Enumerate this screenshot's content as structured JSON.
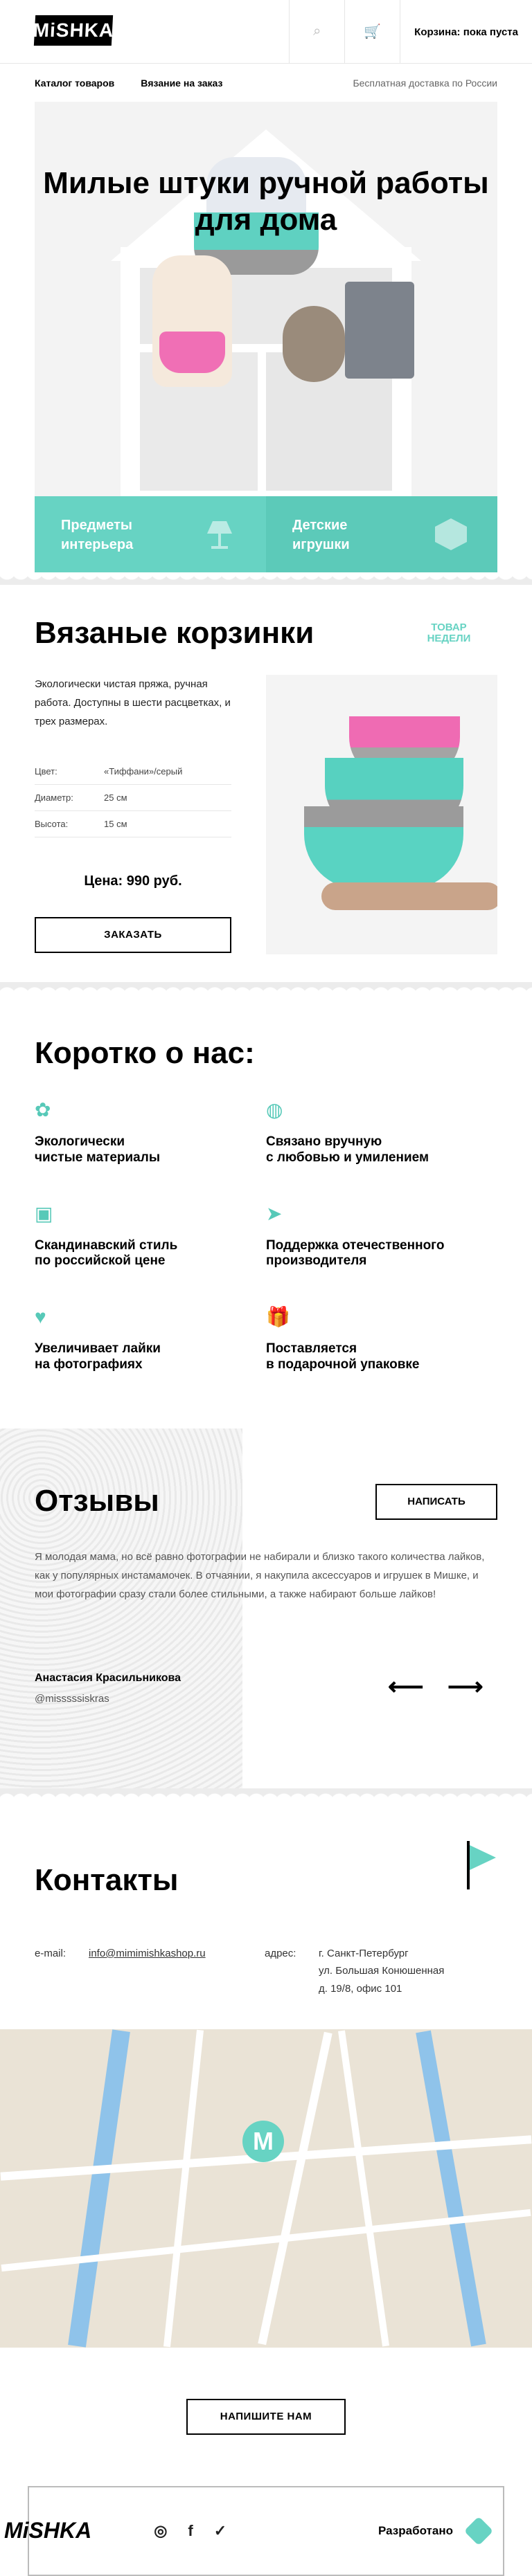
{
  "header": {
    "logo": "MiSHKA",
    "cart": "Корзина: пока пуста"
  },
  "nav": {
    "items": [
      "Каталог товаров",
      "Вязание на заказ"
    ],
    "shipping": "Бесплатная доставка по России"
  },
  "hero": {
    "title": "Милые штуки ручной работы для дома",
    "tiles": [
      "Предметы интерьера",
      "Детские игрушки"
    ]
  },
  "product": {
    "title": "Вязаные корзинки",
    "badge": "ТОВАР НЕДЕЛИ",
    "description": "Экологически чистая пряжа, ручная работа. Доступны в шести расцветках, и трех размерах.",
    "specs": [
      {
        "k": "Цвет:",
        "v": "«Тиффани»/серый"
      },
      {
        "k": "Диаметр:",
        "v": "25 см"
      },
      {
        "k": "Высота:",
        "v": "15 см"
      }
    ],
    "price": "Цена: 990 руб.",
    "button": "ЗАКАЗАТЬ"
  },
  "about": {
    "title": "Коротко о нас:",
    "features": [
      "Экологически\nчистые материалы",
      "Связано вручную\nс любовью и умилением",
      "Скандинавский стиль\nпо российской цене",
      "Поддержка отечественного\nпроизводителя",
      "Увеличивает лайки\nна фотографиях",
      "Поставляется\nв подарочной упаковке"
    ]
  },
  "reviews": {
    "title": "Отзывы",
    "button": "НАПИСАТЬ",
    "text": "Я молодая мама, но всё равно фотографии не набирали и близко такого количества лайков, как у популярных инстамамочек. В отчаянии, я накупила аксессуаров и игрушек в Мишке, и мои фотографии сразу стали более стильными, а также набирают больше лайков!",
    "author": "Анастасия Красильникова",
    "nick": "@misssssiskras",
    "prev": "⟵",
    "next": "⟶"
  },
  "contacts": {
    "title": "Контакты",
    "email_label": "e-mail:",
    "email": "info@mimimishkashop.ru",
    "address_label": "адрес:",
    "address": "г. Санкт-Петербург\nул. Большая Конюшенная\nд. 19/8, офис 101"
  },
  "map": {
    "pin": "M"
  },
  "cta": {
    "button": "НАПИШИТЕ НАМ"
  },
  "footer": {
    "logo": "MiSHKA",
    "socials": [
      "◎",
      "f",
      "✓"
    ],
    "developed": "Разработано"
  },
  "colors": {
    "accent": "#67d3c3"
  }
}
